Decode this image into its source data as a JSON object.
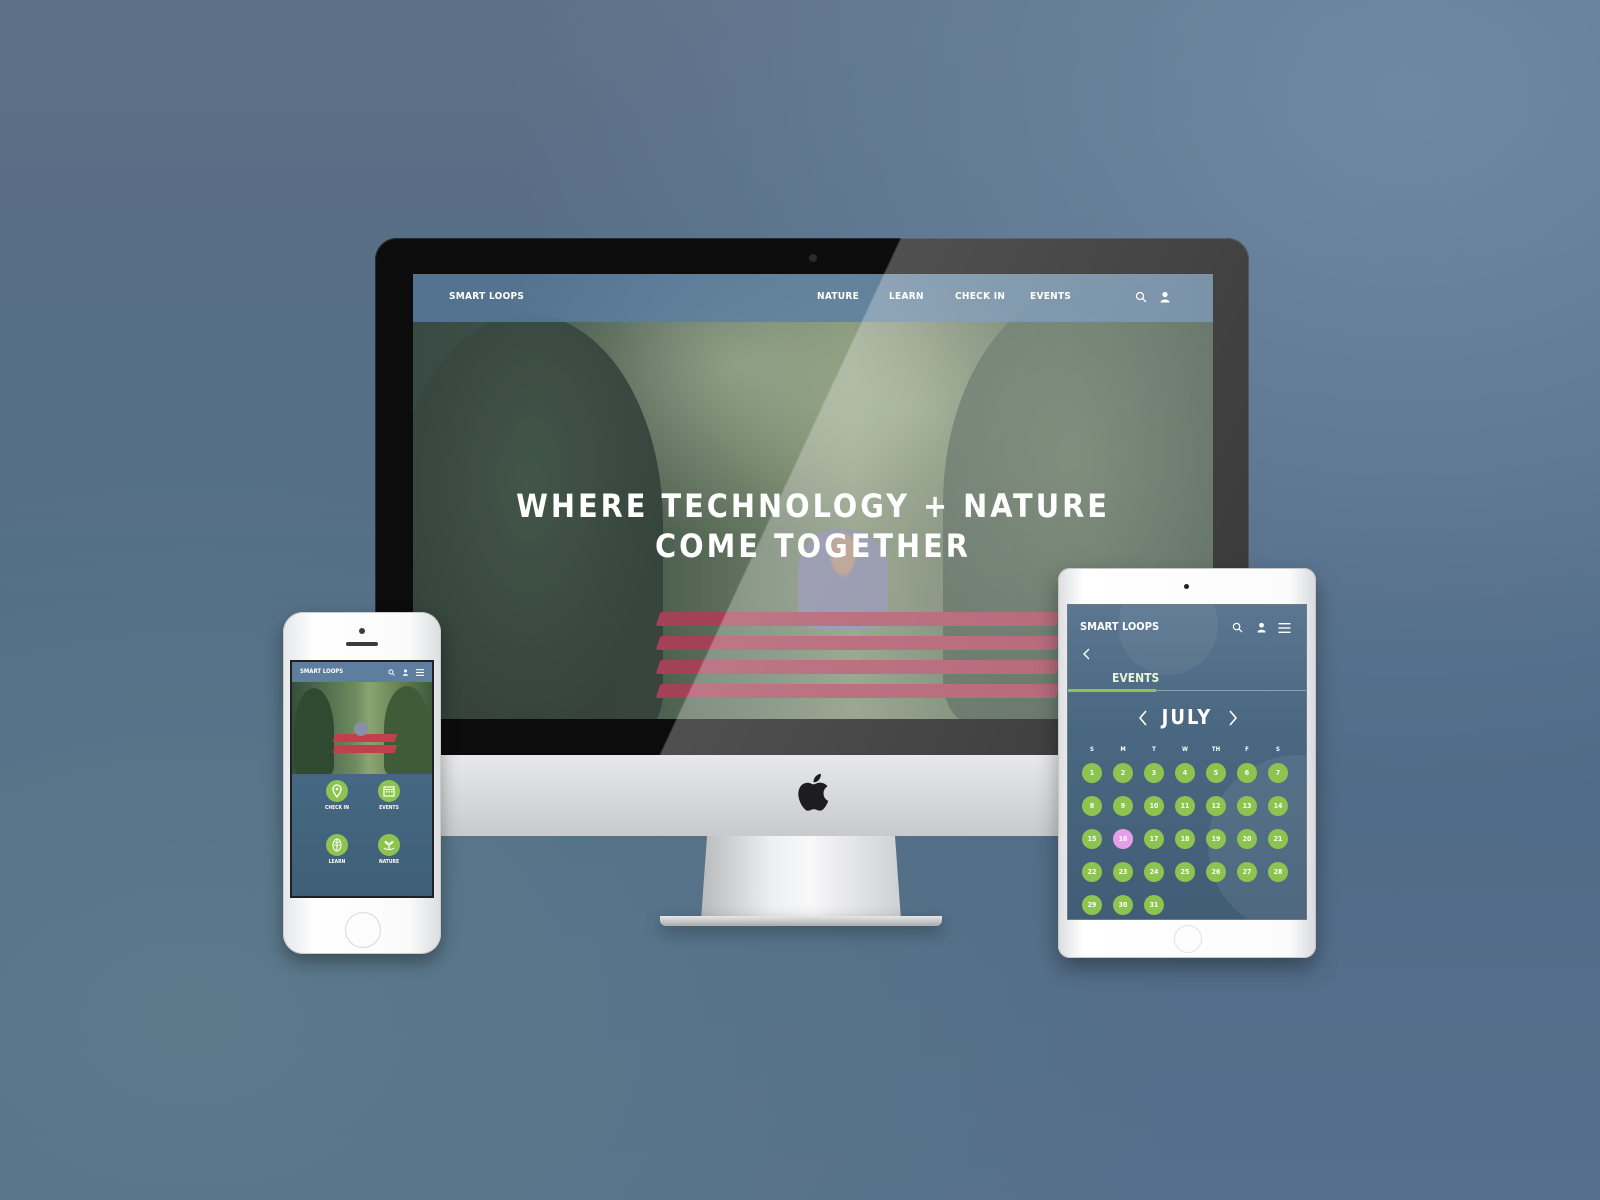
{
  "desktop": {
    "brand": "SMART LOOPS",
    "nav": [
      "NATURE",
      "LEARN",
      "CHECK IN",
      "EVENTS"
    ],
    "hero_line1": "WHERE TECHNOLOGY + NATURE",
    "hero_line2": "COME TOGETHER",
    "icons": [
      "search-icon",
      "user-icon",
      "apple-logo"
    ]
  },
  "phone": {
    "brand": "SMART LOOPS",
    "tiles": [
      {
        "label": "CHECK IN",
        "icon": "location-pin-icon"
      },
      {
        "label": "EVENTS",
        "icon": "calendar-icon"
      },
      {
        "label": "LEARN",
        "icon": "leaf-icon"
      },
      {
        "label": "NATURE",
        "icon": "sprout-icon"
      }
    ],
    "icons": [
      "search-icon",
      "user-icon",
      "menu-icon"
    ]
  },
  "tablet": {
    "brand": "SMART LOOPS",
    "section": "EVENTS",
    "month": "JULY",
    "weekdays": [
      "S",
      "M",
      "T",
      "W",
      "TH",
      "F",
      "S"
    ],
    "days": [
      "1",
      "2",
      "3",
      "4",
      "5",
      "6",
      "7",
      "8",
      "9",
      "10",
      "11",
      "12",
      "13",
      "14",
      "15",
      "16",
      "17",
      "18",
      "19",
      "20",
      "21",
      "22",
      "23",
      "24",
      "25",
      "26",
      "27",
      "28",
      "29",
      "30",
      "31"
    ],
    "today": "16",
    "icons": [
      "search-icon",
      "user-icon",
      "menu-icon",
      "back-chevron-icon",
      "prev-month-icon",
      "next-month-icon"
    ]
  },
  "colors": {
    "accent_green": "#8dc44f",
    "today_pink": "#e59ee8",
    "nav_blue": "#5a7da5",
    "bench_red": "#c23f4d"
  }
}
